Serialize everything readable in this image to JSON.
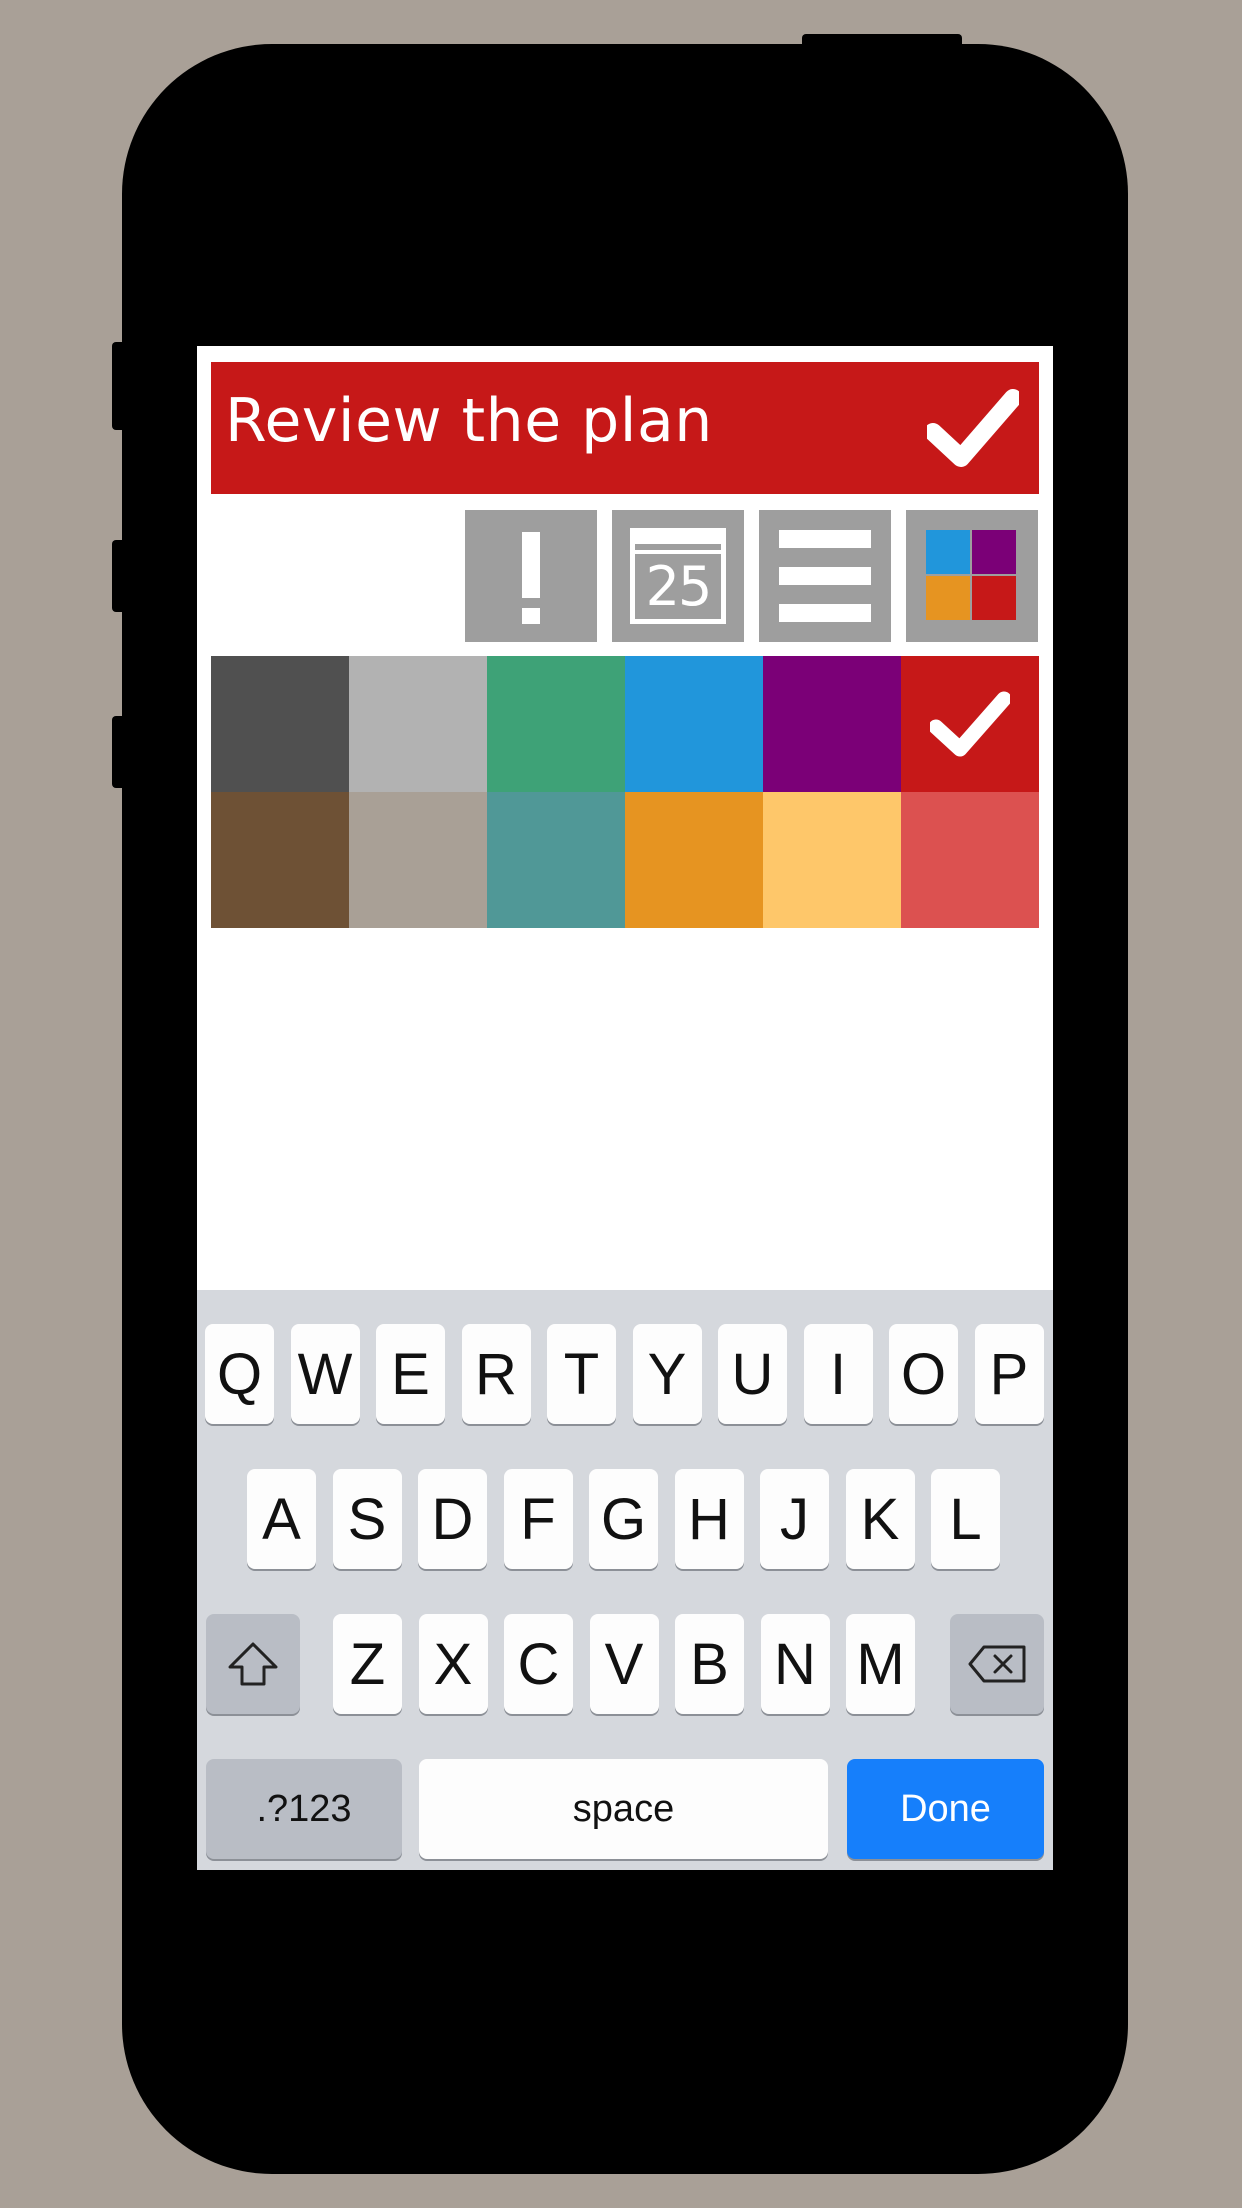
{
  "task": {
    "title": "Review the plan"
  },
  "colors": {
    "accent": "#c61818",
    "tool_gray": "#9e9e9e"
  },
  "toolbar": {
    "items": [
      {
        "name": "priority",
        "icon": "exclamation-icon"
      },
      {
        "name": "due-date",
        "icon": "calendar-icon",
        "label": "25"
      },
      {
        "name": "notes",
        "icon": "list-icon"
      },
      {
        "name": "color",
        "icon": "color-grid-icon",
        "mini_colors": [
          "#2196db",
          "#7b0077",
          "#e69421",
          "#c61818"
        ]
      }
    ]
  },
  "palette": {
    "selected_index": 5,
    "swatches": [
      "#505050",
      "#b2b2b2",
      "#3ea277",
      "#2196db",
      "#7b0077",
      "#c61818",
      "#6e5135",
      "#a9a096",
      "#509897",
      "#e69421",
      "#fec76a",
      "#dc5150"
    ]
  },
  "keyboard": {
    "row1": [
      "Q",
      "W",
      "E",
      "R",
      "T",
      "Y",
      "U",
      "I",
      "O",
      "P"
    ],
    "row2": [
      "A",
      "S",
      "D",
      "F",
      "G",
      "H",
      "J",
      "K",
      "L"
    ],
    "row3": [
      "Z",
      "X",
      "C",
      "V",
      "B",
      "N",
      "M"
    ],
    "shift_icon": "shift-icon",
    "delete_icon": "delete-icon",
    "numbers_label": ".?123",
    "space_label": "space",
    "done_label": "Done"
  }
}
